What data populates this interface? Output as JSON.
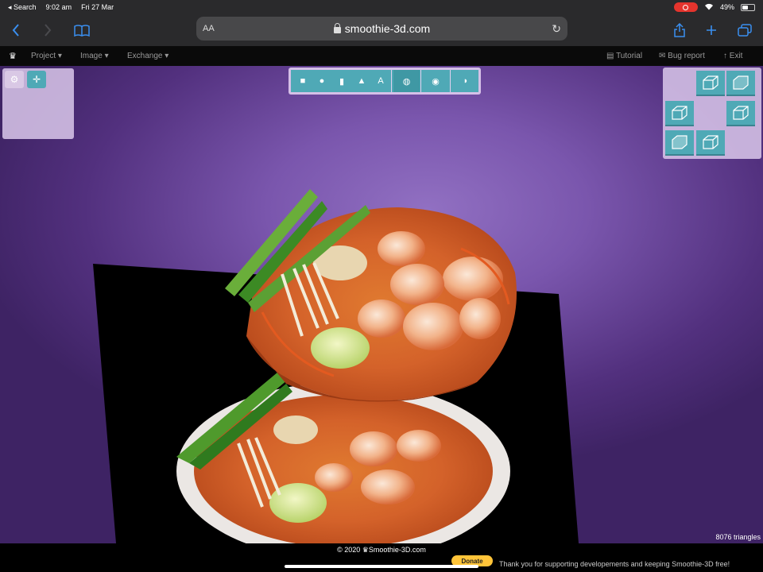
{
  "status_bar": {
    "back_app": "◂ Search",
    "time": "9:02 am",
    "date": "Fri 27 Mar",
    "battery": "49%"
  },
  "browser": {
    "url": "smoothie-3d.com",
    "text_size_label": "AA"
  },
  "app_menu": {
    "items": [
      "Project",
      "Image",
      "Exchange"
    ],
    "right_items": [
      "Tutorial",
      "Bug report",
      "Exit"
    ]
  },
  "toolbar": {
    "text_tool_label": "A"
  },
  "viewport": {
    "triangles": "8076 triangles"
  },
  "footer": {
    "copyright": "© 2020 ♛Smoothie-3D.com",
    "donate_label": "Donate",
    "thanks": "Thank you for supporting developements and keeping Smoothie-3D free!"
  },
  "colors": {
    "accent_teal": "#4fa9b6",
    "ios_blue": "#3a8ff0",
    "donate_yellow": "#ffc439"
  }
}
